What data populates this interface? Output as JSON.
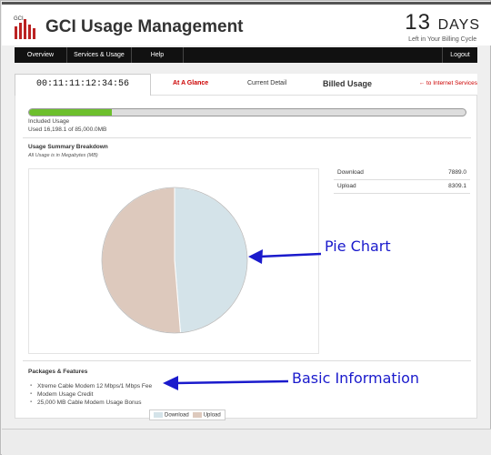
{
  "app": {
    "logo_text": "GCI",
    "title": "GCI Usage Management",
    "days_number": "13",
    "days_word": "Days",
    "days_caption": "Left in Your Billing Cycle"
  },
  "nav": {
    "items": [
      "Overview",
      "Services & Usage",
      "Help"
    ],
    "logout": "Logout"
  },
  "tabs": {
    "timer": "00:11:11:12:34:56",
    "at_a_glance": "At A Glance",
    "current_detail": "Current Detail",
    "billed_usage": "Billed Usage",
    "back_link": "← to Internet Services"
  },
  "usage": {
    "label": "Included Usage",
    "detail": "Used 16,198.1 of 85,000.0MB",
    "used": 16198.1,
    "total": 85000.0
  },
  "summary": {
    "title": "Usage Summary Breakdown",
    "subtitle": "All Usage is in Megabytes (MB)",
    "rows": [
      {
        "label": "Download",
        "value": "7889.0"
      },
      {
        "label": "Upload",
        "value": "8309.1"
      }
    ]
  },
  "chart_data": {
    "type": "pie",
    "categories": [
      "Download",
      "Upload"
    ],
    "values": [
      7889.0,
      8309.1
    ],
    "colors": [
      "#d4e3e9",
      "#ddc9bd"
    ],
    "legend": "bottom"
  },
  "features": {
    "title": "Packages & Features",
    "items": [
      "Xtreme Cable Modem 12 Mbps/1 Mbps Fee",
      "Modem Usage Credit",
      "25,000 MB Cable Modem Usage Bonus"
    ]
  },
  "annotations": {
    "pie": "Pie Chart",
    "info": "Basic Information",
    "color": "#1a1acc"
  }
}
